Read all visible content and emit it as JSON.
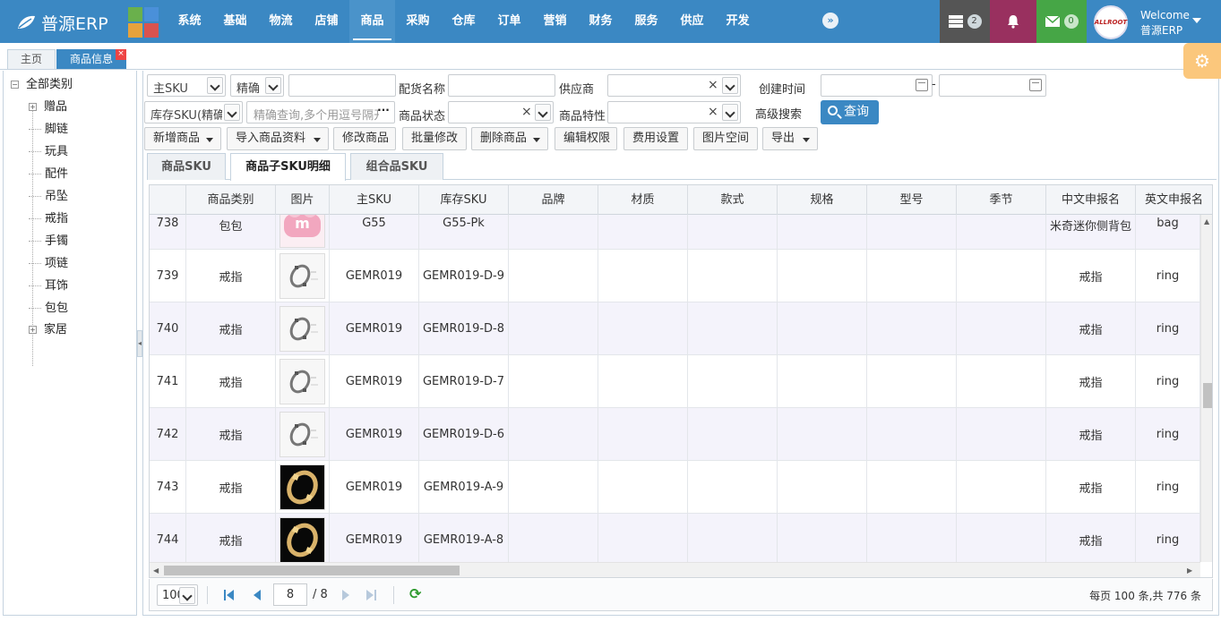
{
  "app": {
    "name": "普源ERP"
  },
  "nav": {
    "items": [
      "系统",
      "基础",
      "物流",
      "店铺",
      "商品",
      "采购",
      "仓库",
      "订单",
      "营销",
      "财务",
      "服务",
      "供应",
      "开发"
    ],
    "active_index": 4
  },
  "header": {
    "tasks_badge": "2",
    "mail_badge": "0",
    "welcome": "Welcome",
    "username": "普源ERP",
    "avatar_text": "ALLROOT"
  },
  "tabs": {
    "home": "主页",
    "current": "商品信息",
    "close": "×"
  },
  "tree": {
    "root": "全部类别",
    "children": [
      {
        "label": "赠品",
        "expandable": true
      },
      {
        "label": "脚链",
        "expandable": false
      },
      {
        "label": "玩具",
        "expandable": false
      },
      {
        "label": "配件",
        "expandable": false
      },
      {
        "label": "吊坠",
        "expandable": false
      },
      {
        "label": "戒指",
        "expandable": false
      },
      {
        "label": "手镯",
        "expandable": false
      },
      {
        "label": "项链",
        "expandable": false
      },
      {
        "label": "耳饰",
        "expandable": false
      },
      {
        "label": "包包",
        "expandable": false
      },
      {
        "label": "家居",
        "expandable": true
      }
    ]
  },
  "filters": {
    "sku_type": "主SKU",
    "match_mode": "精确",
    "sku_value": "",
    "name_label": "配货名称",
    "name_value": "",
    "supplier_label": "供应商",
    "supplier_value": "",
    "created_label": "创建时间",
    "date_from": "",
    "date_sep": "-",
    "date_to": "",
    "stock_sku": "库存SKU(精确",
    "precise_placeholder": "精确查询,多个用逗号隔开",
    "status_label": "商品状态",
    "status_value": "",
    "feature_label": "商品特性",
    "feature_value": "",
    "advanced_label": "高级搜索",
    "query_label": "查询"
  },
  "toolbar": {
    "add": "新增商品",
    "import": "导入商品资料",
    "edit": "修改商品",
    "batch_edit": "批量修改",
    "delete": "删除商品",
    "perm": "编辑权限",
    "fee": "费用设置",
    "images": "图片空间",
    "export": "导出"
  },
  "subtabs": [
    "商品SKU",
    "商品子SKU明细",
    "组合品SKU"
  ],
  "subtab_active": 1,
  "table": {
    "headers": [
      "",
      "商品类别",
      "图片",
      "主SKU",
      "库存SKU",
      "品牌",
      "材质",
      "款式",
      "规格",
      "型号",
      "季节",
      "中文申报名",
      "英文申报名"
    ],
    "rows": [
      {
        "no": "738",
        "cat": "包包",
        "img": "bag",
        "sku": "G55",
        "stock": "G55-Pk",
        "cn": "米奇迷你侧背包",
        "en": "bag"
      },
      {
        "no": "739",
        "cat": "戒指",
        "img": "ring-w",
        "sku": "GEMR019",
        "stock": "GEMR019-D-9",
        "cn": "戒指",
        "en": "ring"
      },
      {
        "no": "740",
        "cat": "戒指",
        "img": "ring-w",
        "sku": "GEMR019",
        "stock": "GEMR019-D-8",
        "cn": "戒指",
        "en": "ring"
      },
      {
        "no": "741",
        "cat": "戒指",
        "img": "ring-w",
        "sku": "GEMR019",
        "stock": "GEMR019-D-7",
        "cn": "戒指",
        "en": "ring"
      },
      {
        "no": "742",
        "cat": "戒指",
        "img": "ring-w",
        "sku": "GEMR019",
        "stock": "GEMR019-D-6",
        "cn": "戒指",
        "en": "ring"
      },
      {
        "no": "743",
        "cat": "戒指",
        "img": "ring-d",
        "sku": "GEMR019",
        "stock": "GEMR019-A-9",
        "cn": "戒指",
        "en": "ring"
      },
      {
        "no": "744",
        "cat": "戒指",
        "img": "ring-d",
        "sku": "GEMR019",
        "stock": "GEMR019-A-8",
        "cn": "戒指",
        "en": "ring"
      }
    ]
  },
  "pager": {
    "page_size": "100",
    "current_page": "8",
    "total_pages": "/ 8",
    "info": "每页 100 条,共 776 条"
  },
  "colors": {
    "primary": "#3b88c3",
    "tasks": "#555555",
    "bell": "#99305f",
    "mail": "#46a646",
    "gear": "#fbc77c"
  }
}
